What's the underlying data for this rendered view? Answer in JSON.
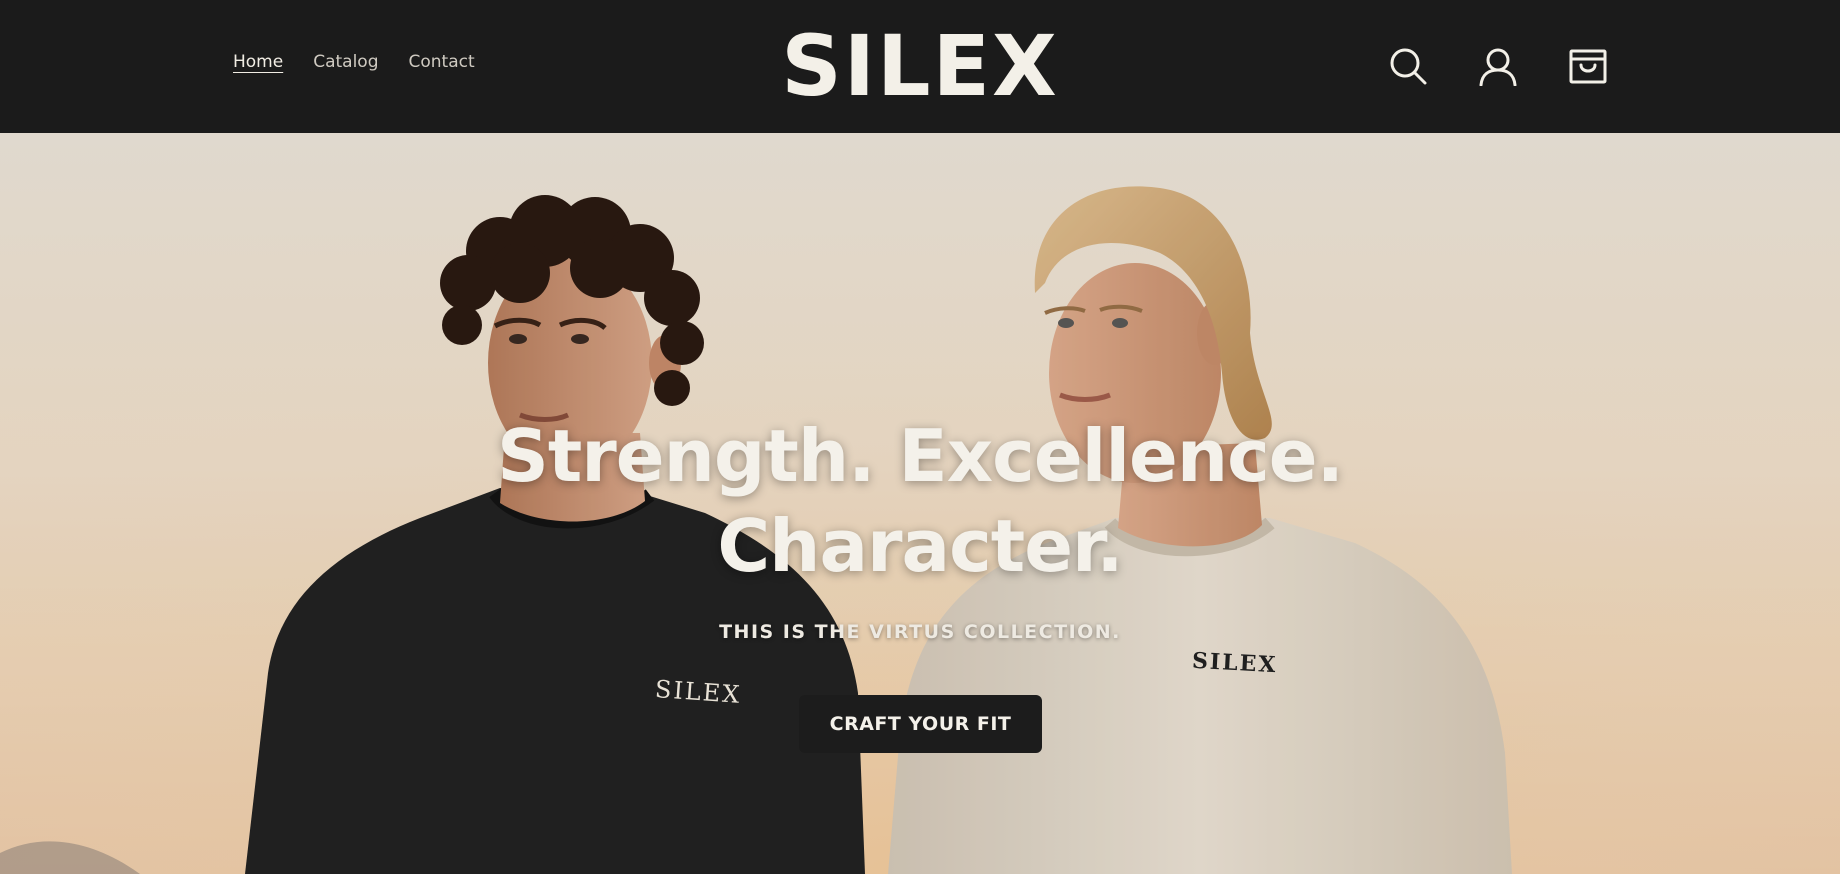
{
  "header": {
    "nav": [
      {
        "label": "Home",
        "active": true
      },
      {
        "label": "Catalog",
        "active": false
      },
      {
        "label": "Contact",
        "active": false
      }
    ],
    "logo": "SILEX",
    "icons": [
      "search-icon",
      "account-icon",
      "cart-icon"
    ]
  },
  "hero": {
    "title_line1": "Strength. Excellence.",
    "title_line2": "Character.",
    "subtitle": "THIS IS THE VIRTUS COLLECTION.",
    "cta_label": "CRAFT YOUR FIT",
    "shirt_logo_left": "SILEX",
    "shirt_logo_right": "SILEX"
  },
  "colors": {
    "header_bg": "#1b1b1b",
    "logo": "#f3f0e8",
    "cta_bg": "#1c1c1c",
    "sky_top": "#efe7db",
    "sky_bottom": "#f1c9a3"
  }
}
